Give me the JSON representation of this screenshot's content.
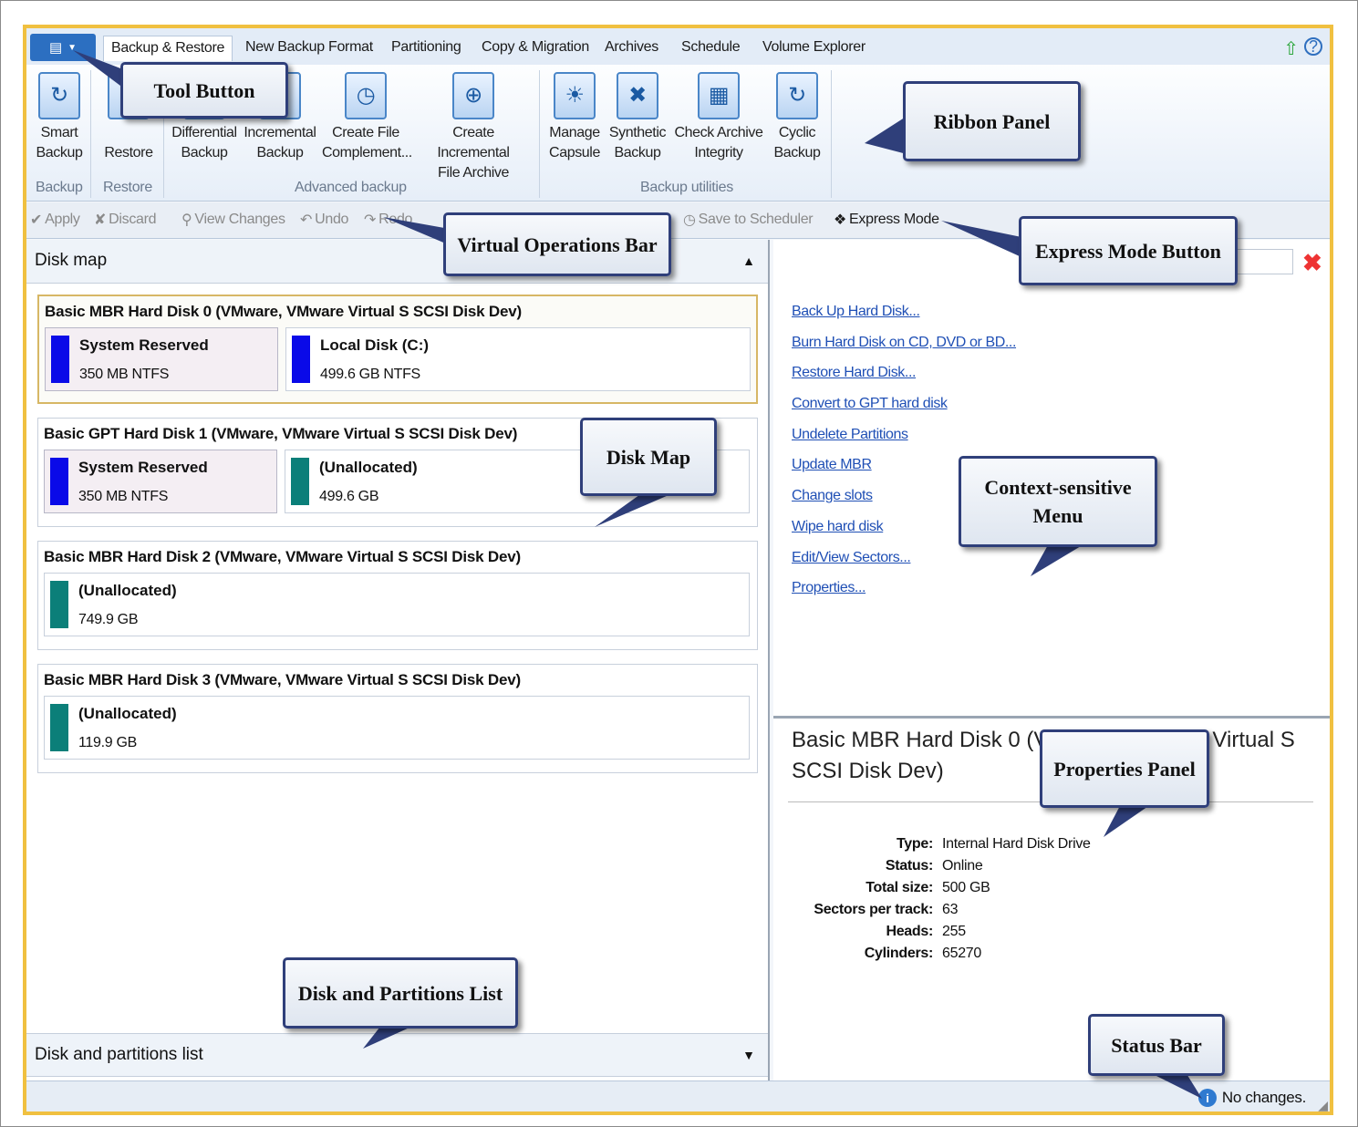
{
  "menubar": {
    "tool_icon": "menu-icon",
    "tabs": [
      "Backup & Restore",
      "New Backup Format",
      "Partitioning",
      "Copy & Migration",
      "Archives",
      "Schedule",
      "Volume Explorer"
    ],
    "up_icon": "green-up-arrow-icon",
    "help_icon": "help-icon"
  },
  "ribbon": {
    "buttons": [
      {
        "line1": "Smart",
        "line2": "Backup"
      },
      {
        "line1": "",
        "line2": "Restore"
      },
      {
        "line1": "Differential",
        "line2": "Backup"
      },
      {
        "line1": "Incremental",
        "line2": "Backup"
      },
      {
        "line1": "Create File",
        "line2": "Complement..."
      },
      {
        "line1": "Create Incremental",
        "line2": "File Archive"
      },
      {
        "line1": "Manage",
        "line2": "Capsule"
      },
      {
        "line1": "Synthetic",
        "line2": "Backup"
      },
      {
        "line1": "Check Archive",
        "line2": "Integrity"
      },
      {
        "line1": "Cyclic",
        "line2": "Backup"
      }
    ],
    "groups": [
      "Backup",
      "Restore",
      "Advanced backup",
      "Backup utilities"
    ]
  },
  "vobar": {
    "apply": "Apply",
    "discard": "Discard",
    "view_changes": "View Changes",
    "undo": "Undo",
    "redo": "Redo",
    "save_to_scheduler": "Save to Scheduler",
    "express_mode": "Express Mode"
  },
  "diskmap": {
    "header": "Disk map",
    "disks": [
      {
        "title": "Basic MBR Hard Disk 0 (VMware, VMware Virtual S SCSI Disk Dev)",
        "parts": [
          {
            "name": "System Reserved",
            "size": "350 MB NTFS"
          },
          {
            "name": "Local Disk (C:)",
            "size": "499.6 GB NTFS"
          }
        ]
      },
      {
        "title": "Basic GPT Hard Disk 1 (VMware, VMware Virtual S SCSI Disk Dev)",
        "parts": [
          {
            "name": "System Reserved",
            "size": "350 MB NTFS"
          },
          {
            "name": "(Unallocated)",
            "size": "499.6 GB"
          }
        ]
      },
      {
        "title": "Basic MBR Hard Disk 2 (VMware, VMware Virtual S SCSI Disk Dev)",
        "parts": [
          {
            "name": "(Unallocated)",
            "size": "749.9 GB"
          }
        ]
      },
      {
        "title": "Basic MBR Hard Disk 3 (VMware, VMware Virtual S SCSI Disk Dev)",
        "parts": [
          {
            "name": "(Unallocated)",
            "size": "119.9 GB"
          }
        ]
      }
    ],
    "colors": {
      "ntfs": "#0a0ae8",
      "unallocated": "#0b7f79"
    }
  },
  "partlist": {
    "header": "Disk and partitions list"
  },
  "context_menu": [
    "Back Up Hard Disk...",
    "Burn Hard Disk on CD, DVD or BD...",
    "Restore Hard Disk...",
    "Convert to GPT hard disk",
    "Undelete Partitions",
    "Update MBR",
    "Change slots",
    "Wipe hard disk",
    "Edit/View Sectors...",
    "Properties..."
  ],
  "properties": {
    "title": "Basic MBR Hard Disk 0 (VMware, VMware Virtual S SCSI Disk Dev)",
    "rows": [
      {
        "k": "Type:",
        "v": "Internal Hard Disk Drive"
      },
      {
        "k": "Status:",
        "v": "Online"
      },
      {
        "k": "Total size:",
        "v": "500 GB"
      },
      {
        "k": "Sectors per track:",
        "v": "63"
      },
      {
        "k": "Heads:",
        "v": "255"
      },
      {
        "k": "Cylinders:",
        "v": "65270"
      }
    ]
  },
  "status": {
    "text": "No changes."
  },
  "callouts": {
    "tool_button": "Tool Button",
    "ribbon_panel": "Ribbon Panel",
    "virtual_ops": "Virtual Operations Bar",
    "express_mode": "Express Mode Button",
    "disk_map": "Disk Map",
    "context_menu_1": "Context-sensitive",
    "context_menu_2": "Menu",
    "properties": "Properties Panel",
    "partitions_list": "Disk and Partitions List",
    "status_bar": "Status Bar"
  }
}
